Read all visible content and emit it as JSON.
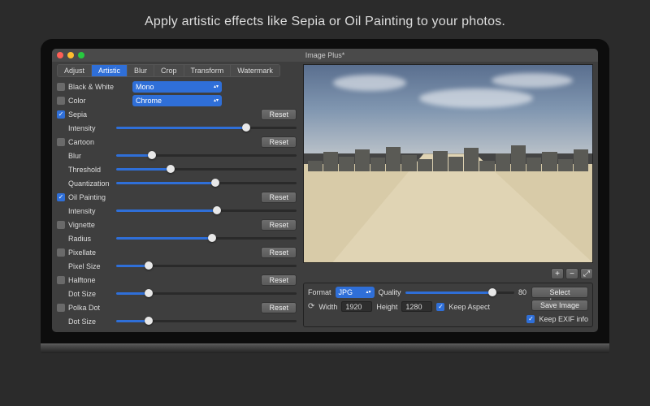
{
  "headline": "Apply artistic effects like Sepia or Oil Painting to your photos.",
  "window": {
    "title": "Image Plus*"
  },
  "tabs": [
    "Adjust",
    "Artistic",
    "Blur",
    "Crop",
    "Transform",
    "Watermark"
  ],
  "active_tab": "Artistic",
  "bw": {
    "label": "Black & White",
    "select": "Mono"
  },
  "color": {
    "label": "Color",
    "select": "Chrome"
  },
  "sepia": {
    "label": "Sepia",
    "intensity": "Intensity",
    "reset": "Reset"
  },
  "cartoon": {
    "label": "Cartoon",
    "blur": "Blur",
    "threshold": "Threshold",
    "quant": "Quantization",
    "reset": "Reset"
  },
  "oil": {
    "label": "Oil Painting",
    "intensity": "Intensity",
    "reset": "Reset"
  },
  "vignette": {
    "label": "Vignette",
    "radius": "Radius",
    "reset": "Reset"
  },
  "pixellate": {
    "label": "Pixellate",
    "size": "Pixel Size",
    "reset": "Reset"
  },
  "halftone": {
    "label": "Halftone",
    "size": "Dot Size",
    "reset": "Reset"
  },
  "polka": {
    "label": "Polka Dot",
    "size": "Dot Size",
    "reset": "Reset"
  },
  "sliders": {
    "sepia_intensity": 72,
    "cartoon_blur": 20,
    "cartoon_threshold": 30,
    "cartoon_quant": 55,
    "oil_intensity": 56,
    "vignette_radius": 53,
    "pixellate_size": 18,
    "halftone_size": 18,
    "polka_size": 18,
    "quality": 80
  },
  "bottom": {
    "format_label": "Format",
    "format_value": "JPG",
    "quality_label": "Quality",
    "quality_value": "80",
    "width_label": "Width",
    "width_value": "1920",
    "height_label": "Height",
    "height_value": "1280",
    "keep_aspect": "Keep Aspect",
    "select_image": "Select Image",
    "save_image": "Save Image",
    "keep_exif": "Keep EXIF info"
  },
  "icons": {
    "plus": "+",
    "minus": "−",
    "fit": "⤢"
  }
}
